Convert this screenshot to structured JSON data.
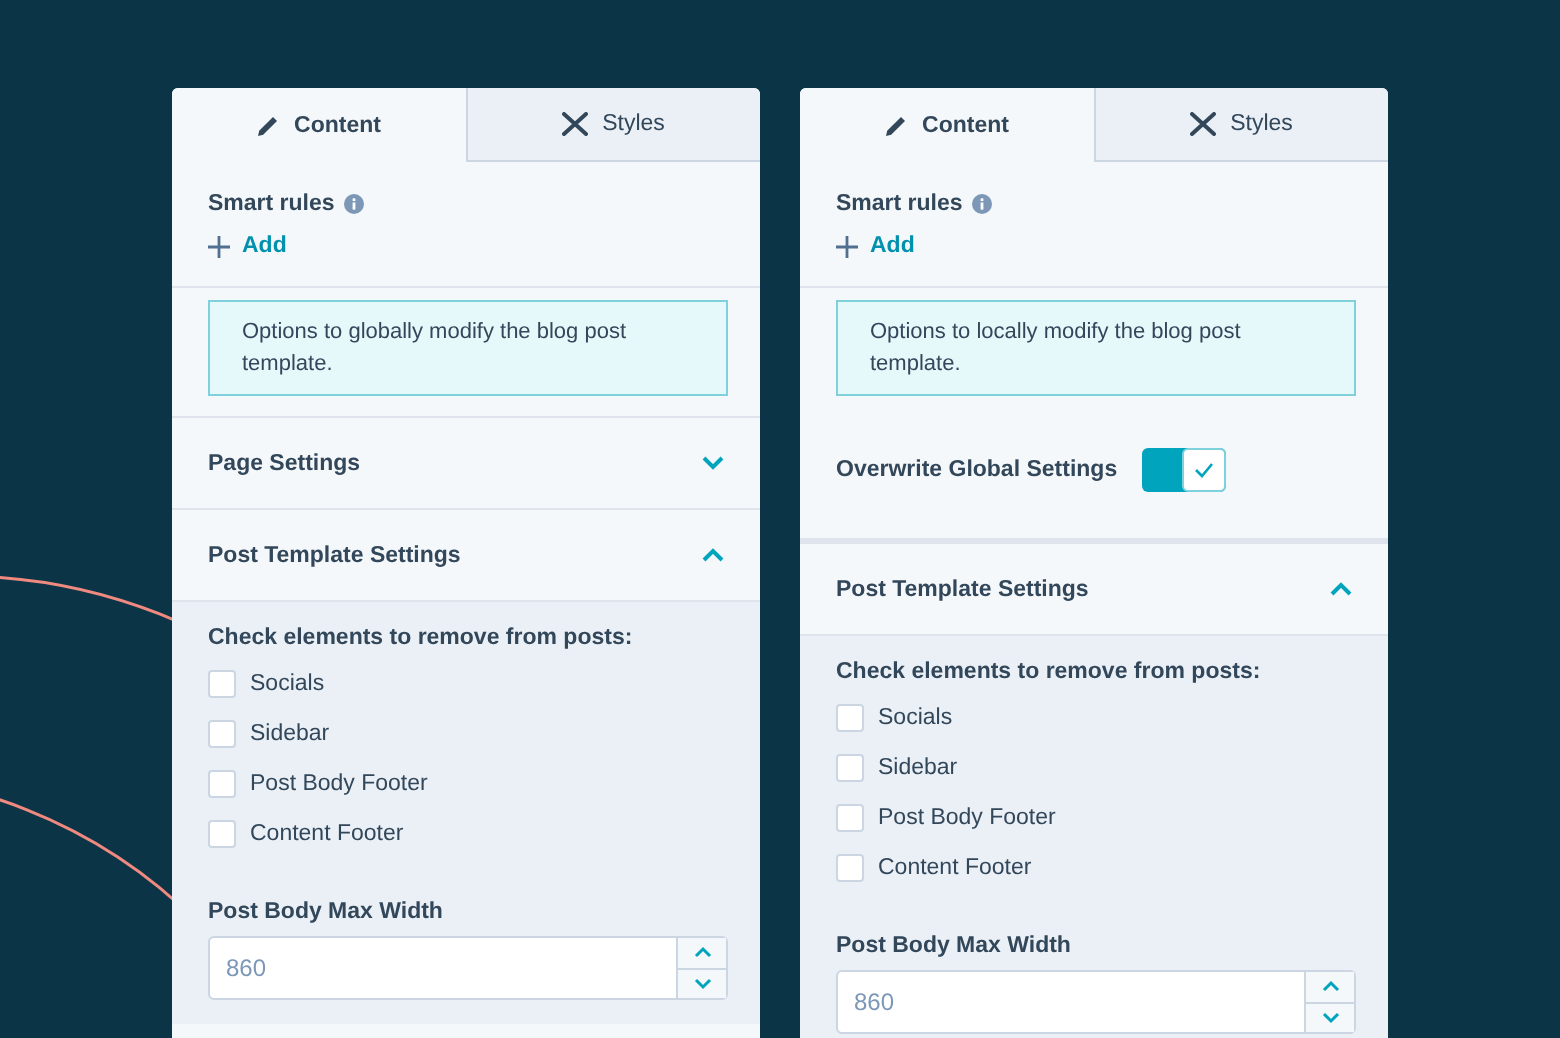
{
  "panels": [
    {
      "tabs": [
        {
          "label": "Content",
          "selected": true
        },
        {
          "label": "Styles",
          "selected": false
        }
      ],
      "smart_rules": {
        "label": "Smart rules",
        "add": "Add"
      },
      "note": "Options to globally modify the blog post template.",
      "sections": [
        {
          "kind": "accordion",
          "title": "Page Settings",
          "expanded": false
        },
        {
          "kind": "accordion",
          "title": "Post Template Settings",
          "expanded": true,
          "body": {
            "heading": "Check elements to remove from posts:",
            "checkboxes": [
              {
                "label": "Socials",
                "checked": false
              },
              {
                "label": "Sidebar",
                "checked": false
              },
              {
                "label": "Post Body Footer",
                "checked": false
              },
              {
                "label": "Content Footer",
                "checked": false
              }
            ],
            "field": {
              "label": "Post Body Max Width",
              "value": "860"
            }
          }
        }
      ]
    },
    {
      "tabs": [
        {
          "label": "Content",
          "selected": true
        },
        {
          "label": "Styles",
          "selected": false
        }
      ],
      "smart_rules": {
        "label": "Smart rules",
        "add": "Add"
      },
      "note": "Options to locally modify the blog post template.",
      "sections": [
        {
          "kind": "toggle",
          "title": "Overwrite Global Settings",
          "on": true
        },
        {
          "kind": "accordion",
          "title": "Post Template Settings",
          "expanded": true,
          "body": {
            "heading": "Check elements to remove from posts:",
            "checkboxes": [
              {
                "label": "Socials",
                "checked": false
              },
              {
                "label": "Sidebar",
                "checked": false
              },
              {
                "label": "Post Body Footer",
                "checked": false
              },
              {
                "label": "Content Footer",
                "checked": false
              }
            ],
            "field": {
              "label": "Post Body Max Width",
              "value": "860"
            }
          }
        }
      ]
    }
  ]
}
